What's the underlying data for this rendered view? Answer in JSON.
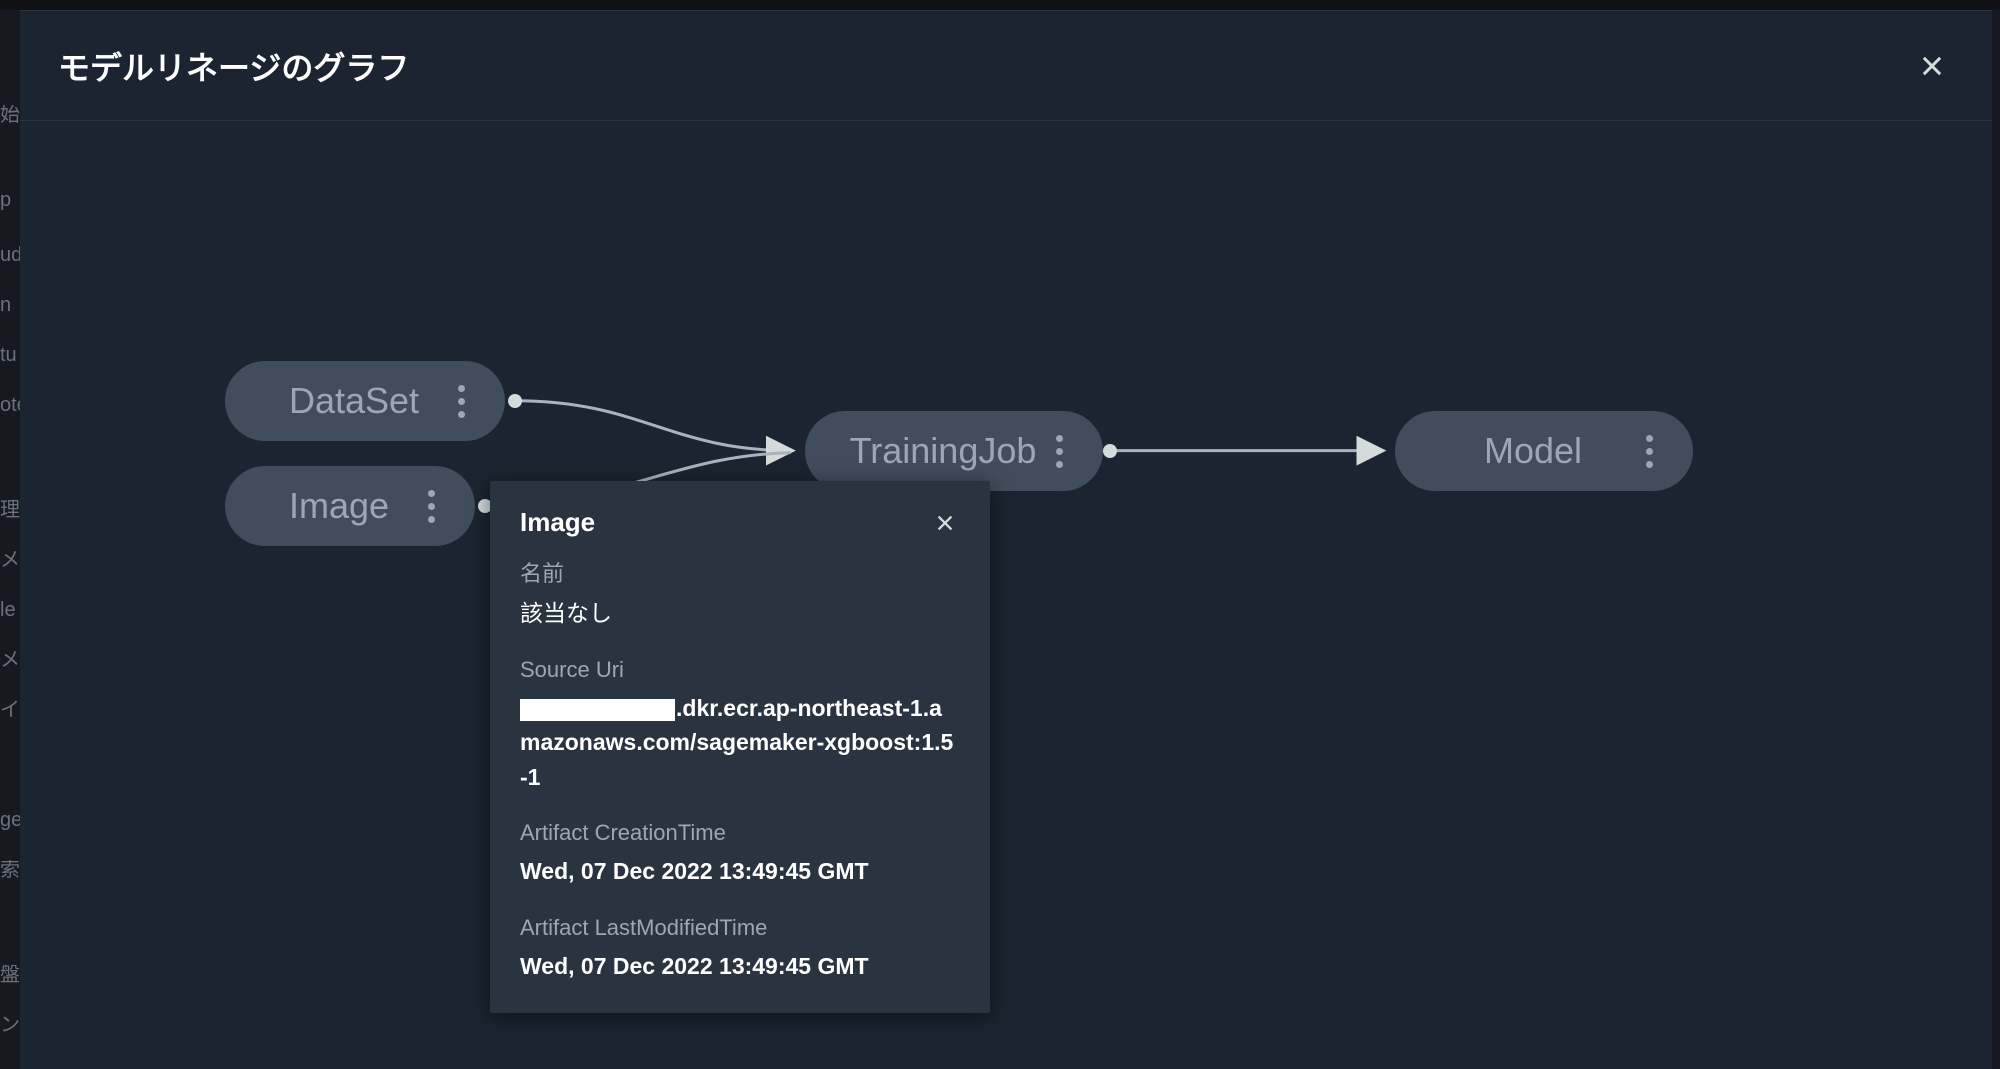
{
  "panel": {
    "title": "モデルリネージのグラフ"
  },
  "nodes": {
    "dataset": {
      "label": "DataSet"
    },
    "image": {
      "label": "Image"
    },
    "trainingjob": {
      "label": "TrainingJob"
    },
    "model": {
      "label": "Model"
    }
  },
  "popover": {
    "title": "Image",
    "name_label": "名前",
    "name_value": "該当なし",
    "source_uri_label": "Source Uri",
    "source_uri_value_suffix": ".dkr.ecr.ap-northeast-1.amazonaws.com/sagemaker-xgboost:1.5-1",
    "creation_label": "Artifact CreationTime",
    "creation_value": "Wed, 07 Dec 2022 13:49:45 GMT",
    "modified_label": "Artifact LastModifiedTime",
    "modified_value": "Wed, 07 Dec 2022 13:49:45 GMT"
  },
  "sidebar_fragments": [
    "始",
    "p",
    "ud",
    "n",
    "tu",
    "ote",
    "理",
    "メ",
    "le",
    "メ",
    "イ",
    "ge",
    "索",
    "盤",
    "ン"
  ]
}
